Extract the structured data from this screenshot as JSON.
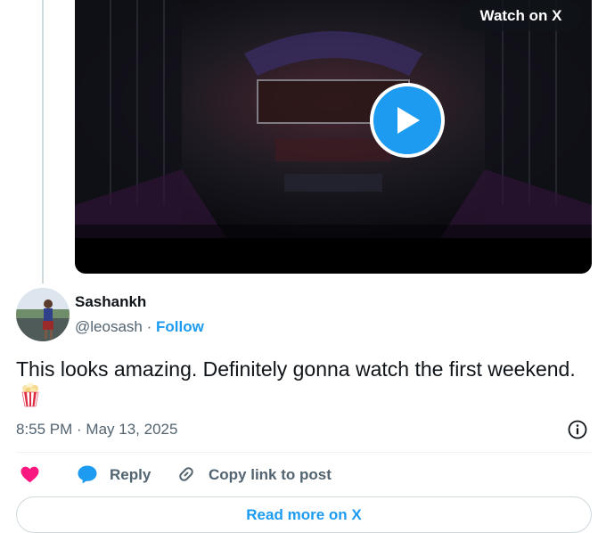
{
  "video": {
    "watch_label": "Watch on X"
  },
  "reply_tweet": {
    "author_name": "Sashankh",
    "author_handle": "@leosash",
    "separator": "·",
    "follow_label": "Follow",
    "text": "This looks amazing. Definitely gonna watch the first weekend.",
    "emoji": "popcorn-icon",
    "timestamp": "8:55 PM · May 13, 2025"
  },
  "actions": {
    "reply_label": "Reply",
    "copy_link_label": "Copy link to post"
  },
  "footer": {
    "read_more_label": "Read more on X"
  },
  "colors": {
    "accent": "#1d9bf0",
    "like": "#f91880",
    "muted_text": "#536471",
    "border": "#cfd9de"
  }
}
